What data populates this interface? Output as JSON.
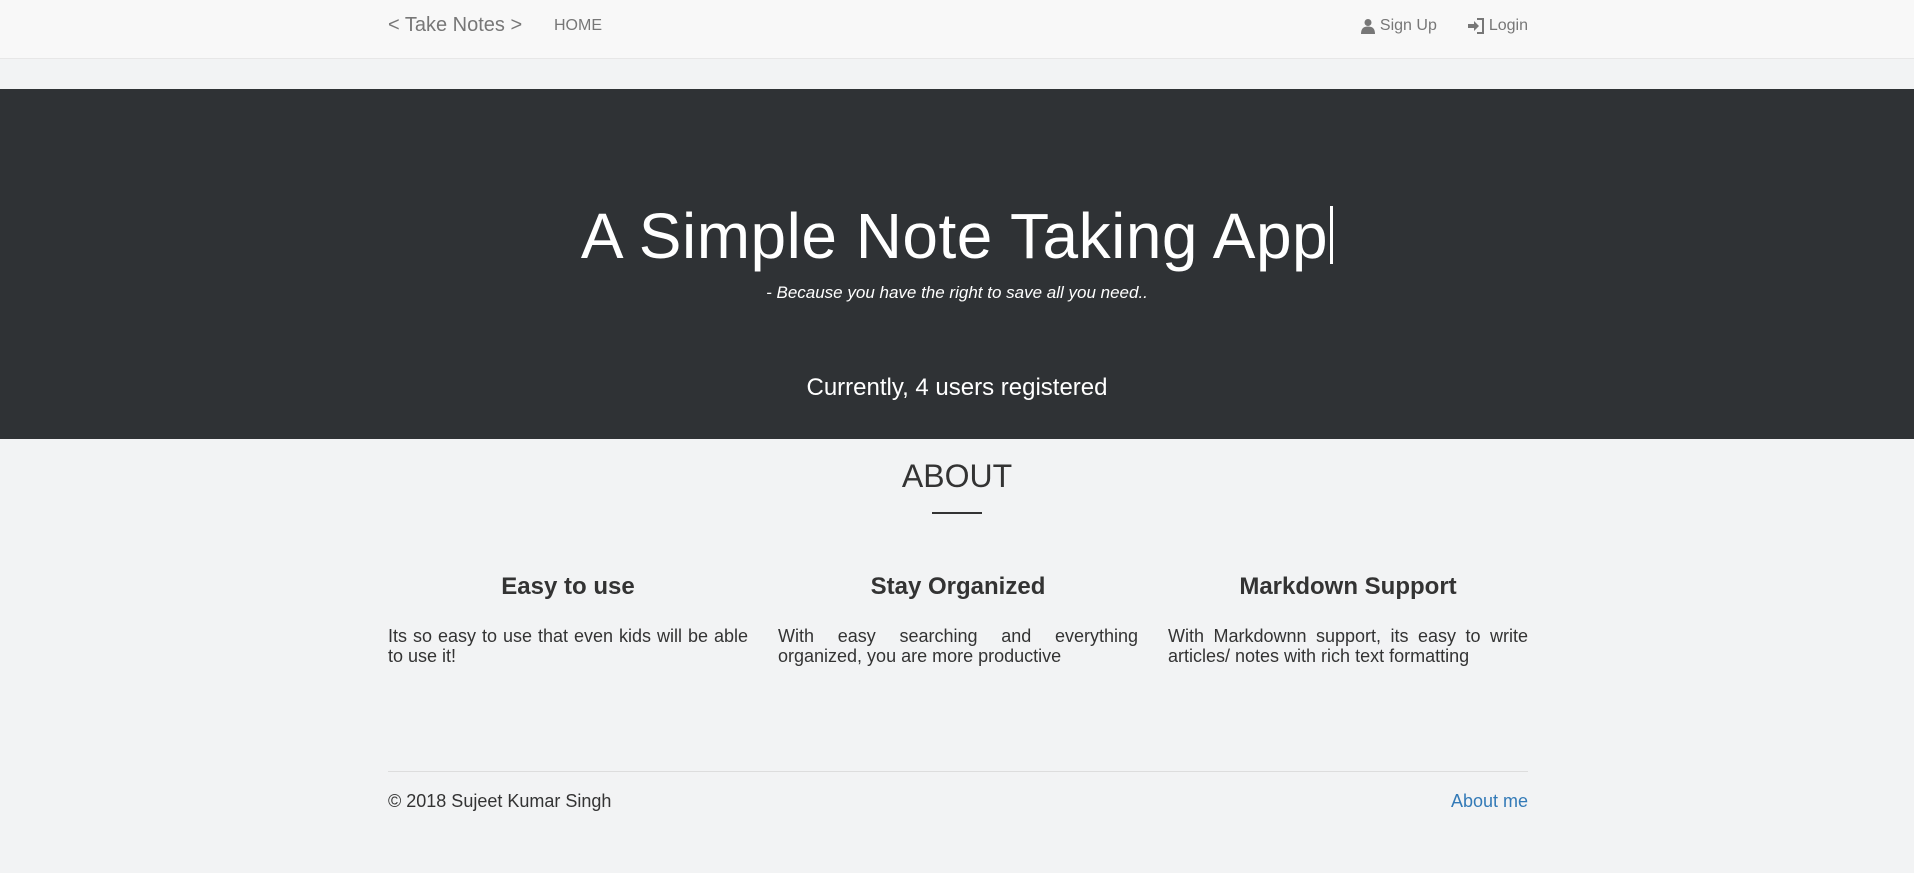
{
  "navbar": {
    "brand": "< Take Notes >",
    "home": "HOME",
    "signup": "Sign Up",
    "login": "Login",
    "signup_icon": "user-icon",
    "login_icon": "login-icon"
  },
  "hero": {
    "title": "A Simple Note Taking App",
    "subtitle": "- Because you have the right to save all you need..",
    "users_text": "Currently, 4 users registered"
  },
  "about": {
    "heading": "ABOUT",
    "features": [
      {
        "title": "Easy to use",
        "text": "Its so easy to use that even kids will be able to use it!"
      },
      {
        "title": "Stay Organized",
        "text": "With easy searching and everything organized, you are more productive"
      },
      {
        "title": "Markdown Support",
        "text": "With Markdownn support, its easy to write articles/ notes with rich text formatting"
      }
    ]
  },
  "footer": {
    "copyright": "© 2018 Sujeet Kumar Singh",
    "about_me": "About me"
  },
  "colors": {
    "hero_bg": "#2f3235",
    "page_bg": "#f2f3f4",
    "link": "#337ab7"
  }
}
